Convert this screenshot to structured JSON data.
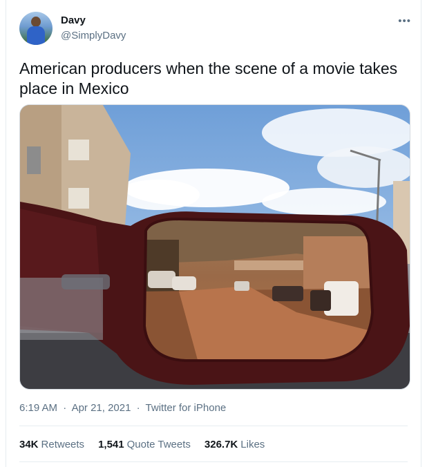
{
  "user": {
    "name": "Davy",
    "handle": "@SimplyDavy"
  },
  "tweet": {
    "text": "American producers when the scene of a movie takes place in Mexico",
    "time": "6:19 AM",
    "date": "Apr 21, 2021",
    "source": "Twitter for iPhone",
    "separator": "·"
  },
  "stats": {
    "retweets_value": "34K",
    "retweets_label": "Retweets",
    "quotes_value": "1,541",
    "quotes_label": "Quote Tweets",
    "likes_value": "326.7K",
    "likes_label": "Likes"
  },
  "icons": {
    "more": "more-horizontal-icon"
  },
  "colors": {
    "text": "#0f1419",
    "secondary": "#5b7083",
    "border": "#e6ecf0"
  }
}
